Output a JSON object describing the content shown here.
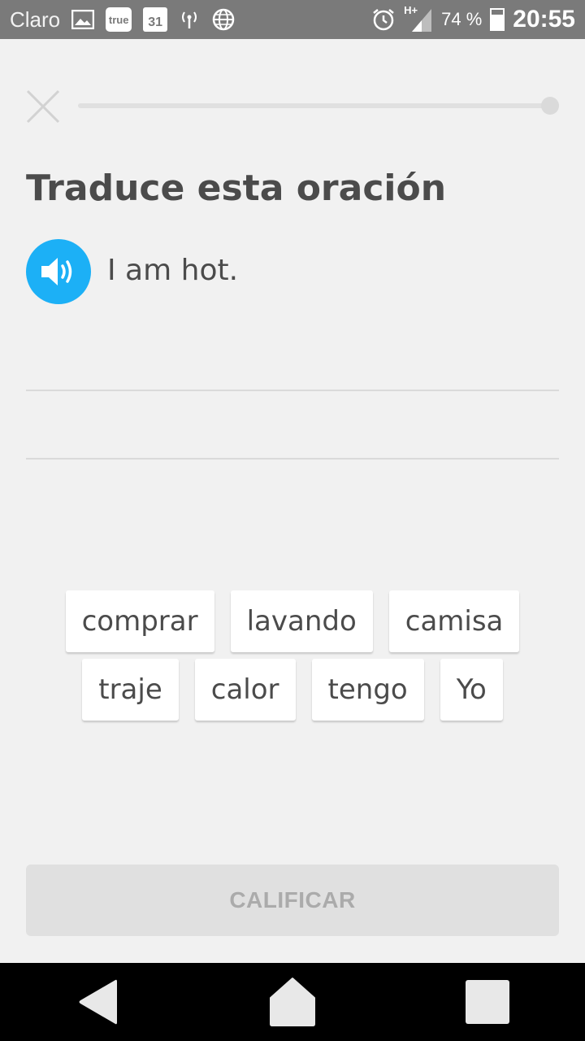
{
  "status_bar": {
    "carrier": "Claro",
    "true_badge": "true",
    "calendar_day": "31",
    "network": "H+",
    "battery": "74 %",
    "time": "20:55",
    "battery_level": 0.74
  },
  "header": {
    "progress": 0
  },
  "exercise": {
    "title": "Traduce esta oración",
    "prompt": "I am hot."
  },
  "word_bank": {
    "row1": [
      "comprar",
      "lavando",
      "camisa"
    ],
    "row2": [
      "traje",
      "calor",
      "tengo",
      "Yo"
    ]
  },
  "footer": {
    "check_label": "CALIFICAR"
  },
  "colors": {
    "accent": "#1cb0f6",
    "text": "#4b4b4b",
    "background": "#f1f1f1"
  }
}
